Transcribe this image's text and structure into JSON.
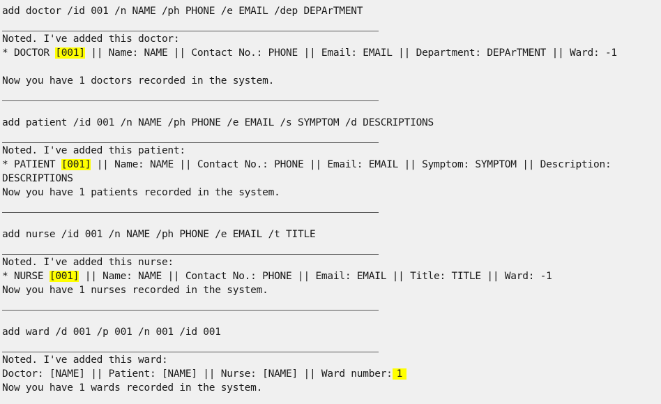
{
  "terminal": {
    "doctor": {
      "command": "add doctor /id 001 /n NAME /ph PHONE /e EMAIL /dep DEPArTMENT",
      "noted": "Noted. I've added this doctor:",
      "entry_prefix": "* DOCTOR ",
      "entry_id": "[001]",
      "entry_rest": " || Name: NAME || Contact No.: PHONE || Email: EMAIL || Department: DEPArTMENT || Ward: -1",
      "count": "Now you have 1 doctors recorded in the system."
    },
    "patient": {
      "command": "add patient /id 001 /n NAME /ph PHONE /e EMAIL /s SYMPTOM /d DESCRIPTIONS",
      "noted": "Noted. I've added this patient:",
      "entry_prefix": "* PATIENT ",
      "entry_id": "[001]",
      "entry_rest": " || Name: NAME || Contact No.: PHONE || Email: EMAIL || Symptom: SYMPTOM || Description:",
      "entry_wrap": "DESCRIPTIONS",
      "count": "Now you have 1 patients recorded in the system."
    },
    "nurse": {
      "command": "add nurse /id 001 /n NAME /ph PHONE /e EMAIL /t TITLE",
      "noted": "Noted. I've added this nurse:",
      "entry_prefix": "* NURSE ",
      "entry_id": "[001]",
      "entry_rest": " || Name: NAME || Contact No.: PHONE || Email: EMAIL || Title: TITLE || Ward: -1",
      "count": "Now you have 1 nurses recorded in the system."
    },
    "ward": {
      "command": "add ward /d 001 /p 001 /n 001 /id 001",
      "noted": "Noted. I've added this ward:",
      "entry_prefix": "Doctor: [NAME] || Patient: [NAME] || Nurse: [NAME] || Ward number:",
      "entry_number": "1",
      "count": "Now you have 1 wards recorded in the system."
    },
    "highlight_color": "#ffff00",
    "background_color": "#f0f0f0",
    "separator_color": "#555555"
  }
}
